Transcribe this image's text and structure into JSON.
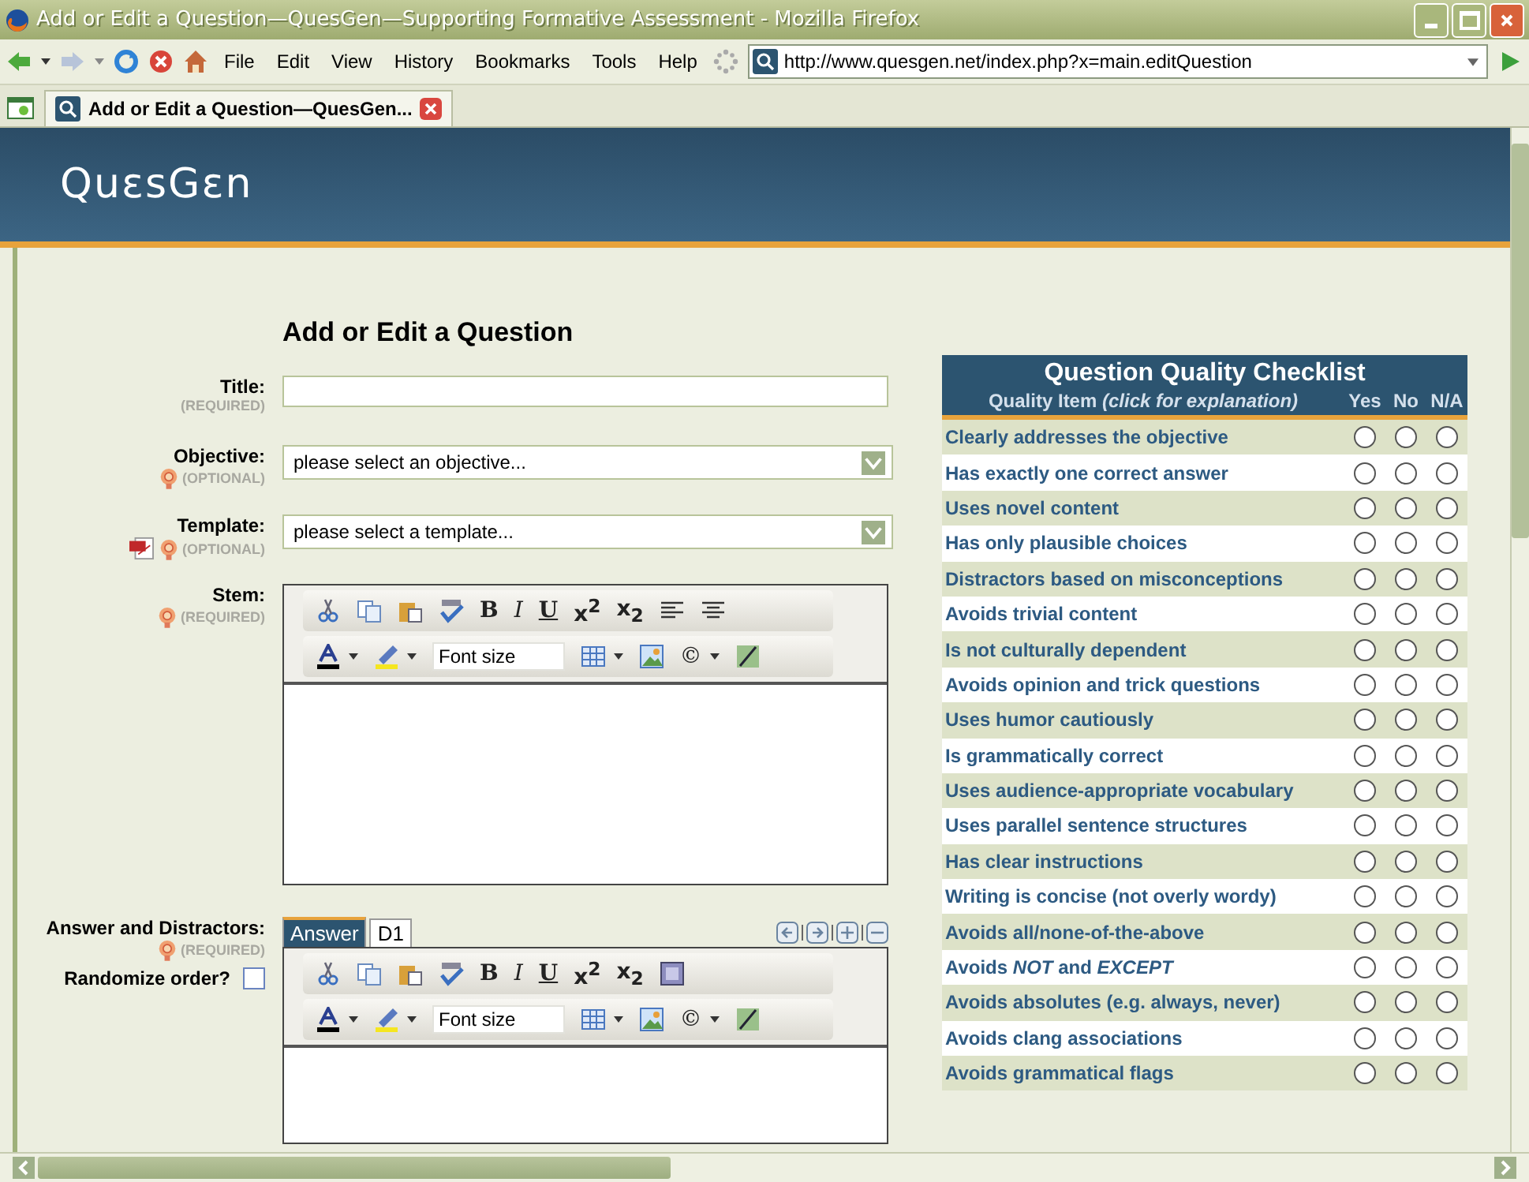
{
  "window": {
    "title": "Add or Edit a Question—QuesGen—Supporting Formative Assessment - Mozilla Firefox"
  },
  "menu": [
    "File",
    "Edit",
    "View",
    "History",
    "Bookmarks",
    "Tools",
    "Help"
  ],
  "address": {
    "value": "http://www.quesgen.net/index.php?x=main.editQuestion"
  },
  "tabs": [
    {
      "label": "Add or Edit a Question—QuesGen...",
      "selected": true
    }
  ],
  "site": {
    "logo": "QuεsGεn"
  },
  "form": {
    "heading": "Add or Edit a Question",
    "fields": [
      {
        "kind": "text",
        "label": "Title:",
        "note": "(REQUIRED)"
      },
      {
        "kind": "select",
        "label": "Objective:",
        "note": "(OPTIONAL)",
        "badges": [
          {
            "kind": "help"
          }
        ],
        "placeholder": "please select an objective..."
      },
      {
        "kind": "select",
        "label": "Template:",
        "note": "(OPTIONAL)",
        "badges": [
          {
            "kind": "pdf"
          },
          {
            "kind": "help"
          }
        ],
        "placeholder": "please select a template..."
      },
      {
        "kind": "editor",
        "label": "Stem:",
        "note": "(REQUIRED)",
        "badges": [
          {
            "kind": "help"
          }
        ],
        "toolbar_rows": [
          [
            {
              "kind": "cut"
            },
            {
              "kind": "copy"
            },
            {
              "kind": "paste"
            },
            {
              "kind": "spellcheck"
            },
            {
              "kind": "bold",
              "text": "B"
            },
            {
              "kind": "italic",
              "text": "I"
            },
            {
              "kind": "underline",
              "text": "U"
            },
            {
              "kind": "script",
              "text": "x$^{2}$"
            },
            {
              "kind": "script",
              "text": "x$_{2}$"
            },
            {
              "kind": "align-left"
            },
            {
              "kind": "align-center"
            }
          ],
          [
            {
              "kind": "font-color"
            },
            {
              "kind": "highlight"
            },
            {
              "kind": "select",
              "text": "Font size"
            },
            {
              "kind": "table"
            },
            {
              "kind": "image"
            },
            {
              "kind": "symbol",
              "text": "©"
            },
            {
              "kind": "word-count"
            }
          ]
        ]
      }
    ],
    "answers": {
      "label": "Answer and Distractors:",
      "note": "(REQUIRED)",
      "badges": [
        {
          "kind": "help"
        }
      ],
      "randomize": {
        "label": "Randomize order?",
        "checked": false
      },
      "tabs": [
        {
          "label": "Answer",
          "selected": true
        },
        {
          "label": "D1",
          "selected": false
        }
      ],
      "toolbar_rows": [
        [
          {
            "kind": "cut"
          },
          {
            "kind": "copy"
          },
          {
            "kind": "paste"
          },
          {
            "kind": "spellcheck"
          },
          {
            "kind": "bold",
            "text": "B"
          },
          {
            "kind": "italic",
            "text": "I"
          },
          {
            "kind": "underline",
            "text": "U"
          },
          {
            "kind": "script",
            "text": "x$^{2}$"
          },
          {
            "kind": "script",
            "text": "x$_{2}$"
          },
          {
            "kind": "template"
          }
        ],
        [
          {
            "kind": "font-color"
          },
          {
            "kind": "highlight"
          },
          {
            "kind": "select",
            "text": "Font size"
          },
          {
            "kind": "table"
          },
          {
            "kind": "image"
          },
          {
            "kind": "symbol",
            "text": "©"
          },
          {
            "kind": "word-count"
          }
        ]
      ]
    }
  },
  "checklist": {
    "title": "Question Quality Checklist",
    "item_header": "Quality Item *(click for explanation)*",
    "columns": [
      "Yes",
      "No",
      "N/A"
    ],
    "items": [
      {
        "text": "Clearly addresses the objective",
        "choices": [
          {
            "selected": false
          },
          {
            "selected": false
          },
          {
            "selected": false
          }
        ]
      },
      {
        "text": "Has exactly one correct answer",
        "choices": [
          {
            "selected": false
          },
          {
            "selected": false
          },
          {
            "selected": false
          }
        ]
      },
      {
        "text": "Uses novel content",
        "choices": [
          {
            "selected": false
          },
          {
            "selected": false
          },
          {
            "selected": false
          }
        ]
      },
      {
        "text": "Has only plausible choices",
        "choices": [
          {
            "selected": false
          },
          {
            "selected": false
          },
          {
            "selected": false
          }
        ]
      },
      {
        "text": "Distractors based on misconceptions",
        "choices": [
          {
            "selected": false
          },
          {
            "selected": false
          },
          {
            "selected": false
          }
        ]
      },
      {
        "text": "Avoids trivial content",
        "choices": [
          {
            "selected": false
          },
          {
            "selected": false
          },
          {
            "selected": false
          }
        ]
      },
      {
        "text": "Is not culturally dependent",
        "choices": [
          {
            "selected": false
          },
          {
            "selected": false
          },
          {
            "selected": false
          }
        ]
      },
      {
        "text": "Avoids opinion and trick questions",
        "choices": [
          {
            "selected": false
          },
          {
            "selected": false
          },
          {
            "selected": false
          }
        ]
      },
      {
        "text": "Uses humor cautiously",
        "choices": [
          {
            "selected": false
          },
          {
            "selected": false
          },
          {
            "selected": false
          }
        ]
      },
      {
        "text": "Is grammatically correct",
        "choices": [
          {
            "selected": false
          },
          {
            "selected": false
          },
          {
            "selected": false
          }
        ]
      },
      {
        "text": "Uses audience-appropriate vocabulary",
        "choices": [
          {
            "selected": false
          },
          {
            "selected": false
          },
          {
            "selected": false
          }
        ]
      },
      {
        "text": "Uses parallel sentence structures",
        "choices": [
          {
            "selected": false
          },
          {
            "selected": false
          },
          {
            "selected": false
          }
        ]
      },
      {
        "text": "Has clear instructions",
        "choices": [
          {
            "selected": false
          },
          {
            "selected": false
          },
          {
            "selected": false
          }
        ]
      },
      {
        "text": "Writing is concise (not overly wordy)",
        "choices": [
          {
            "selected": false
          },
          {
            "selected": false
          },
          {
            "selected": false
          }
        ]
      },
      {
        "text": "Avoids all/none-of-the-above",
        "choices": [
          {
            "selected": false
          },
          {
            "selected": false
          },
          {
            "selected": false
          }
        ]
      },
      {
        "text": "Avoids *NOT* and *EXCEPT*",
        "choices": [
          {
            "selected": false
          },
          {
            "selected": false
          },
          {
            "selected": false
          }
        ]
      },
      {
        "text": "Avoids absolutes (e.g. always, never)",
        "choices": [
          {
            "selected": false
          },
          {
            "selected": false
          },
          {
            "selected": false
          }
        ]
      },
      {
        "text": "Avoids clang associations",
        "choices": [
          {
            "selected": false
          },
          {
            "selected": false
          },
          {
            "selected": false
          }
        ]
      },
      {
        "text": "Avoids grammatical flags",
        "choices": [
          {
            "selected": false
          },
          {
            "selected": false
          },
          {
            "selected": false
          }
        ]
      }
    ]
  }
}
